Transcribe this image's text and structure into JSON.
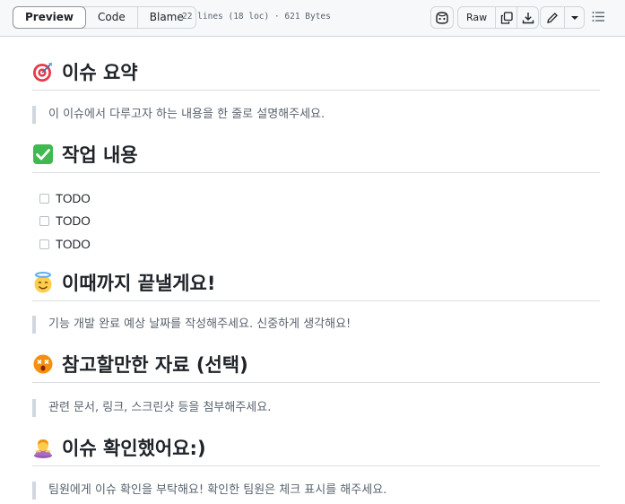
{
  "toolbar": {
    "tabs": [
      "Preview",
      "Code",
      "Blame"
    ],
    "file_meta": "22 lines (18 loc) · 621 Bytes",
    "raw_label": "Raw"
  },
  "sections": [
    {
      "heading": "이슈 요약",
      "icon": "direct-hit-icon",
      "quote": "이 이슈에서 다루고자 하는 내용을 한 줄로 설명해주세요."
    },
    {
      "heading": "작업 내용",
      "icon": "check-mark-button-icon",
      "tasks": [
        "TODO",
        "TODO",
        "TODO"
      ]
    },
    {
      "heading": "이때까지 끝낼게요!",
      "icon": "smiling-face-with-halo-icon",
      "quote": "기능 개발 완료 예상 날짜를 작성해주세요. 신중하게 생각해요!"
    },
    {
      "heading": "참고할만한 자료 (선택)",
      "icon": "dizzy-face-icon",
      "quote": "관련 문서, 링크, 스크린샷 등을 첨부해주세요."
    },
    {
      "heading": "이슈 확인했어요:)",
      "icon": "person-bowing-icon",
      "quote": "팀원에게 이슈 확인을 부탁해요! 확인한 팀원은 체크 표시를 해주세요."
    }
  ],
  "colors": {
    "toolbar_bg": "#f6f8fa",
    "border": "#d0d7de",
    "text": "#1f2328",
    "muted": "#59636e",
    "checkbox_green": "#3fb950"
  }
}
